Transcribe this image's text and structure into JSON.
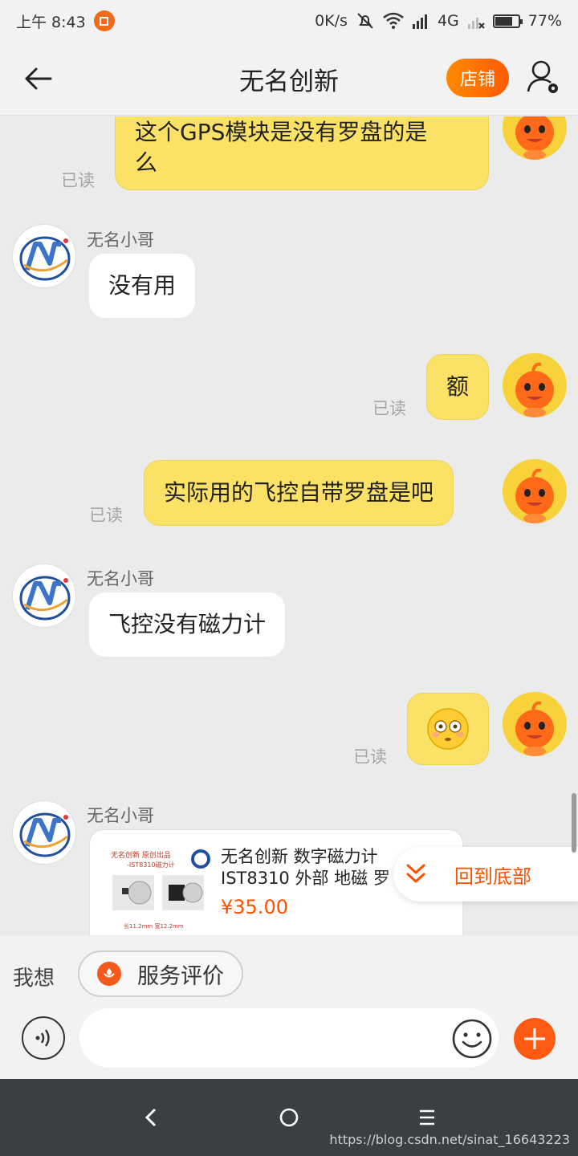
{
  "status_bar": {
    "time": "上午 8:43",
    "net_speed": "0K/s",
    "network": "4G",
    "battery": "77%",
    "battery_level": 0.77
  },
  "header": {
    "title": "无名创新",
    "shop_label": "店铺"
  },
  "messages": [
    {
      "side": "me",
      "text_lines": [
        "这个GPS模块是没有罗盘的是",
        "么"
      ],
      "read": "已读"
    },
    {
      "side": "them",
      "sender": "无名小哥",
      "text": "没有用"
    },
    {
      "side": "me",
      "text": "额",
      "read": "已读"
    },
    {
      "side": "me",
      "text": "实际用的飞控自带罗盘是吧",
      "read": "已读"
    },
    {
      "side": "them",
      "sender": "无名小哥",
      "text": "飞控没有磁力计"
    },
    {
      "side": "me",
      "emoji": "flushed-emoji",
      "read": "已读"
    },
    {
      "side": "them",
      "sender": "无名小哥",
      "product": {
        "title": "无名创新 数字磁力计 IST8310 外部 地磁 罗盘",
        "price": "¥35.00",
        "image_caption_1": "无名创新 原创出品",
        "image_caption_2": "-IST8310磁力计",
        "image_size_caption": "长11.2mm 宽12.2mm"
      }
    }
  ],
  "back_to_bottom": "回到底部",
  "quick_bar": {
    "label": "我想",
    "chip_label": "服务评价"
  },
  "input": {
    "placeholder": ""
  },
  "watermark": "https://blog.csdn.net/sinat_16643223",
  "colors": {
    "accent": "#ff5000",
    "bubble_me": "#fbe165",
    "bubble_them": "#ffffff",
    "background": "#ebebeb"
  }
}
